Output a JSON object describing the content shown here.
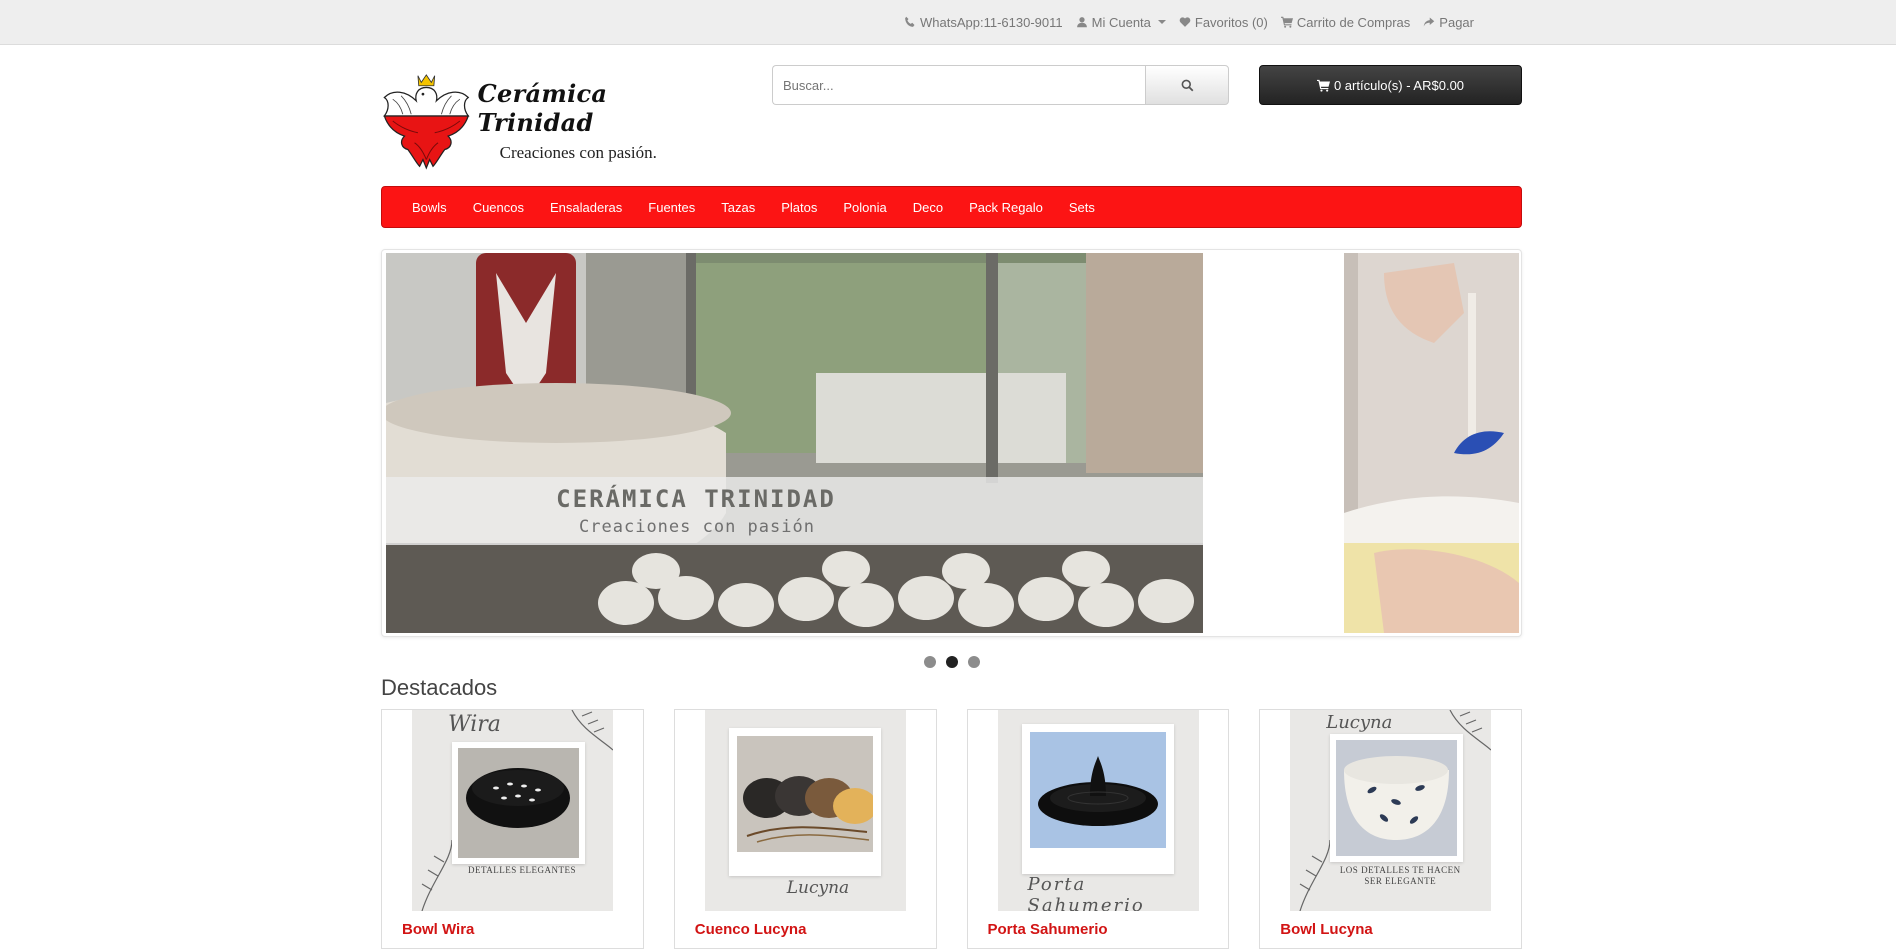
{
  "topbar": {
    "whatsapp": "WhatsApp:11-6130-9011",
    "account": "Mi Cuenta",
    "wishlist": "Favoritos (0)",
    "cart": "Carrito de Compras",
    "checkout": "Pagar"
  },
  "header": {
    "logo_name": "Cerámica Trinidad",
    "logo_tagline": "Creaciones con pasión.",
    "search_placeholder": "Buscar...",
    "cart_button": "0 artículo(s) - AR$0.00"
  },
  "nav": {
    "items": [
      "Bowls",
      "Cuencos",
      "Ensaladeras",
      "Fuentes",
      "Tazas",
      "Platos",
      "Polonia",
      "Deco",
      "Pack Regalo",
      "Sets"
    ]
  },
  "slideshow": {
    "caption_title": "CERÁMICA TRINIDAD",
    "caption_sub": "Creaciones con pasión",
    "active_dot": 2
  },
  "featured": {
    "title": "Destacados",
    "products": [
      {
        "name": "Bowl Wira",
        "script": "Wira",
        "caption": "DETALLES ELEGANTES"
      },
      {
        "name": "Cuenco Lucyna",
        "script": "Lucyna",
        "caption": ""
      },
      {
        "name": "Porta Sahumerio",
        "script": "Porta Sahumerio",
        "caption": ""
      },
      {
        "name": "Bowl Lucyna",
        "script": "Lucyna",
        "caption": "LOS DETALLES TE HACEN SER ELEGANTE"
      }
    ]
  },
  "colors": {
    "nav_red": "#fc1414",
    "product_title_red": "#d21414",
    "cart_button_dark": "#232323"
  }
}
